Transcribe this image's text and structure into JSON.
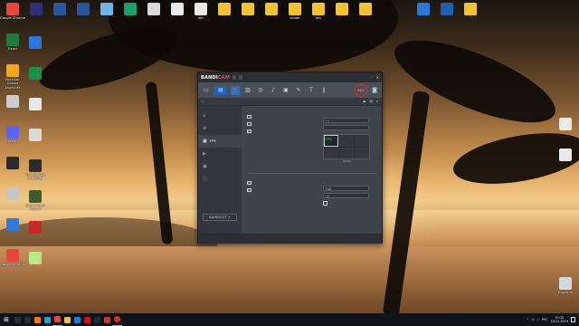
{
  "desktop": {
    "icons_left": [
      {
        "label": "Google Chrome",
        "color": "#e8453c"
      },
      {
        "label": "Excel",
        "color": "#1f7a44"
      },
      {
        "label": "Rockstar Games Launcher",
        "color": "#f4a81d"
      },
      {
        "label": "",
        "color": "#c9ccd1"
      },
      {
        "label": "Discord",
        "color": "#5865f2"
      },
      {
        "label": "",
        "color": "#2b2b2b"
      },
      {
        "label": "",
        "color": "#c6c6c6"
      },
      {
        "label": "",
        "color": "#2f7bd6"
      },
      {
        "label": "Google Chrome",
        "color": "#e8453c"
      }
    ],
    "icons_left2": [
      {
        "label": "",
        "color": "#2a78d6"
      },
      {
        "label": "",
        "color": "#1e8f4a"
      },
      {
        "label": "",
        "color": "#e8e8e8"
      },
      {
        "label": "",
        "color": "#d9d9d9"
      },
      {
        "label": "Epic Games Launcher",
        "color": "#2b2b2b"
      },
      {
        "label": "Grand Theft Auto V",
        "color": "#3d5c2f"
      },
      {
        "label": "",
        "color": "#c62828"
      },
      {
        "label": "",
        "color": "#b8e986"
      }
    ],
    "icons_top": [
      {
        "label": "",
        "color": "#2e2f7a"
      },
      {
        "label": "",
        "color": "#2b579a"
      },
      {
        "label": "",
        "color": "#2b579a"
      },
      {
        "label": "",
        "color": "#6fb6e6"
      },
      {
        "label": "",
        "color": "#1d9e6a"
      },
      {
        "label": "",
        "color": "#d9d9d9"
      },
      {
        "label": "",
        "color": "#e9e9e9"
      },
      {
        "label": "нет",
        "color": "#e9e9e9"
      },
      {
        "label": "",
        "color": "#f1c232"
      },
      {
        "label": "",
        "color": "#f1c232"
      },
      {
        "label": "",
        "color": "#f1c232"
      },
      {
        "label": "loader",
        "color": "#f1c232"
      },
      {
        "label": "key",
        "color": "#f1c232"
      },
      {
        "label": "",
        "color": "#f1c232"
      },
      {
        "label": "",
        "color": "#f1c232"
      }
    ],
    "icons_right_top": [
      {
        "label": "",
        "color": "#2a78d6"
      },
      {
        "label": "",
        "color": "#1f5fae"
      },
      {
        "label": "",
        "color": "#f1c232"
      }
    ],
    "icons_right": [
      {
        "label": "",
        "color": "#e9e9e9"
      },
      {
        "label": "",
        "color": "#e9e9e9"
      },
      {
        "label": "Корзина",
        "color": "#cfd8e3"
      }
    ]
  },
  "bandicam": {
    "logo_a": "BANDI",
    "logo_b": "CAM",
    "pill1": "",
    "pill2": "",
    "min": "–",
    "close": "✕",
    "rec": "REC",
    "search_text": "",
    "sidebar": [
      {
        "label": "",
        "icon": "home-icon",
        "glyph": "⌂"
      },
      {
        "label": "",
        "icon": "gear-icon",
        "glyph": "⚙"
      },
      {
        "label": "FPS",
        "icon": "fps-icon",
        "glyph": "▦"
      },
      {
        "label": "",
        "icon": "video-icon",
        "glyph": "▶"
      },
      {
        "label": "",
        "icon": "image-icon",
        "glyph": "▣"
      },
      {
        "label": "",
        "icon": "info-icon",
        "glyph": "ⓘ"
      }
    ],
    "brand": "BANDICUT ↗",
    "fps_section": {
      "title": "",
      "opt1": "",
      "opt2": "",
      "opt3": "",
      "opt3_checked": true,
      "hotkey1": "F5",
      "hotkey2": "",
      "grid_label": "FPS"
    },
    "limit_section": {
      "title": "",
      "opt1": "",
      "opt1_checked": true,
      "opt2": "",
      "opt2_checked": true,
      "hotkey": "F10",
      "value": "30",
      "only_rec": ""
    },
    "footer": ""
  },
  "taskbar": {
    "start_glyph": "⊞",
    "apps": [
      {
        "name": "search",
        "color": "#2a2d33"
      },
      {
        "name": "task-view",
        "color": "#2a2d33"
      },
      {
        "name": "firefox",
        "color": "#ff7a18"
      },
      {
        "name": "edge",
        "color": "#1fa0d8"
      },
      {
        "name": "chrome",
        "color": "#e8453c"
      },
      {
        "name": "explorer",
        "color": "#f1c232"
      },
      {
        "name": "store",
        "color": "#2a78d6"
      },
      {
        "name": "netflix",
        "color": "#e50914"
      },
      {
        "name": "steam",
        "color": "#1b2838"
      },
      {
        "name": "app",
        "color": "#c0392b"
      },
      {
        "name": "bandicam",
        "color": "#d92c2c"
      }
    ],
    "lang": "РУС",
    "time": "19:32",
    "date": "18.01.2019"
  }
}
